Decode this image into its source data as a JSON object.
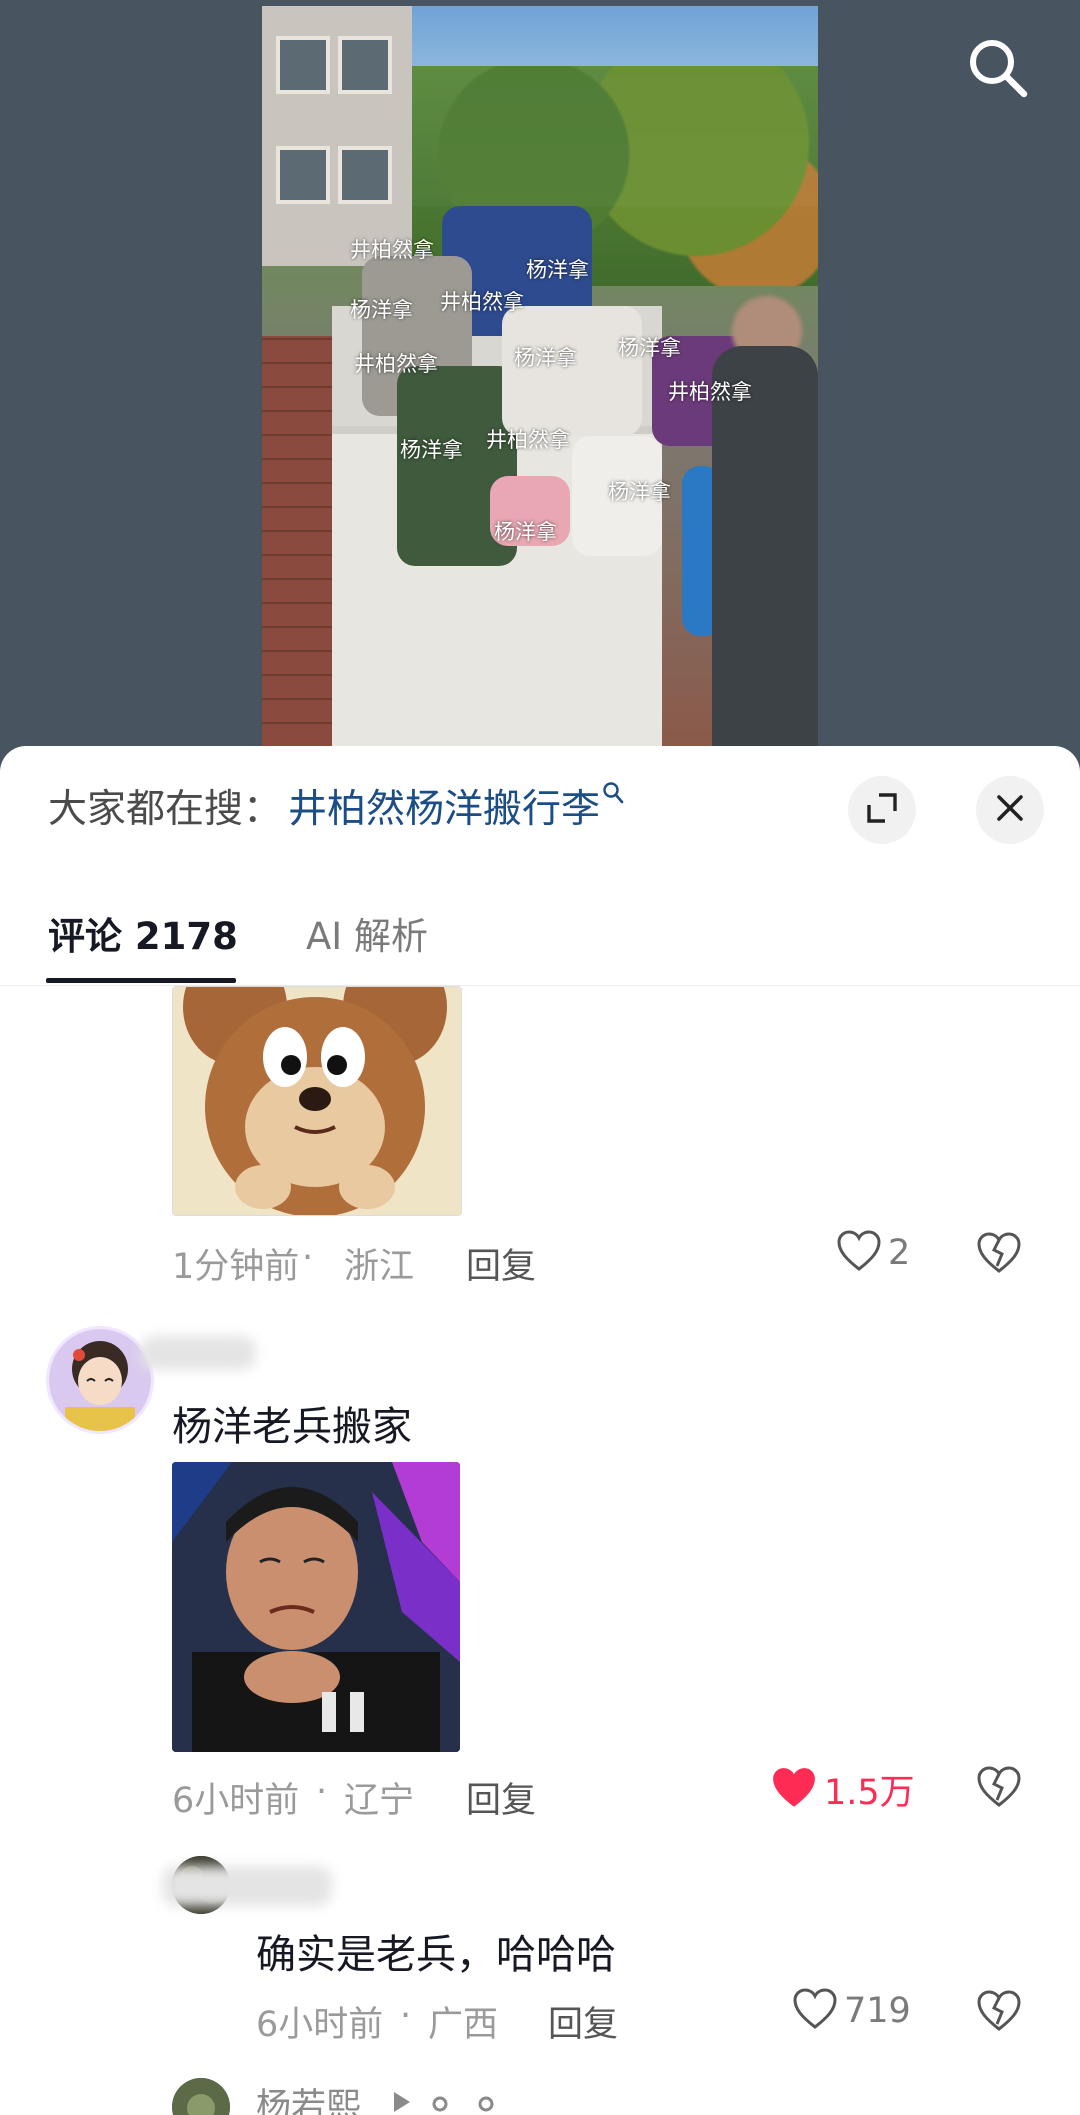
{
  "video": {
    "watermarks": [
      {
        "text": "井柏然拿"
      },
      {
        "text": "杨洋拿"
      },
      {
        "text": "杨洋拿"
      },
      {
        "text": "井柏然拿"
      },
      {
        "text": "井柏然拿"
      },
      {
        "text": "杨洋拿"
      },
      {
        "text": "杨洋拿"
      },
      {
        "text": "井柏然拿"
      },
      {
        "text": "杨洋拿"
      },
      {
        "text": "井柏然拿"
      },
      {
        "text": "杨洋拿"
      },
      {
        "text": "杨洋拿"
      }
    ],
    "search_icon": "search-icon"
  },
  "sheet": {
    "hot_search_prefix": "大家都在搜：",
    "hot_search_term": "井柏然杨洋搬行李",
    "expand_icon": "expand-icon",
    "close_icon": "close-icon",
    "tabs": [
      {
        "label": "评论 2178",
        "active": true
      },
      {
        "label": "AI 解析",
        "active": false
      }
    ]
  },
  "comments": [
    {
      "sticker": "jerry-mouse-sticker",
      "time": "1分钟前",
      "location": "浙江",
      "reply_label": "回复",
      "likes": "2",
      "liked": false
    },
    {
      "avatar": "anime-avatar",
      "text": "杨洋老兵搬家",
      "sticker": "man-crying-sticker",
      "time": "6小时前",
      "location": "辽宁",
      "reply_label": "回复",
      "likes": "1.5万",
      "liked": true,
      "accent": "#fe2c55"
    },
    {
      "avatar": "dark-avatar",
      "text": "确实是老兵，哈哈哈",
      "time": "6小时前",
      "location": "广西",
      "reply_label": "回复",
      "likes": "719",
      "liked": false
    },
    {
      "username": "杨若熙"
    }
  ],
  "sep": "·"
}
